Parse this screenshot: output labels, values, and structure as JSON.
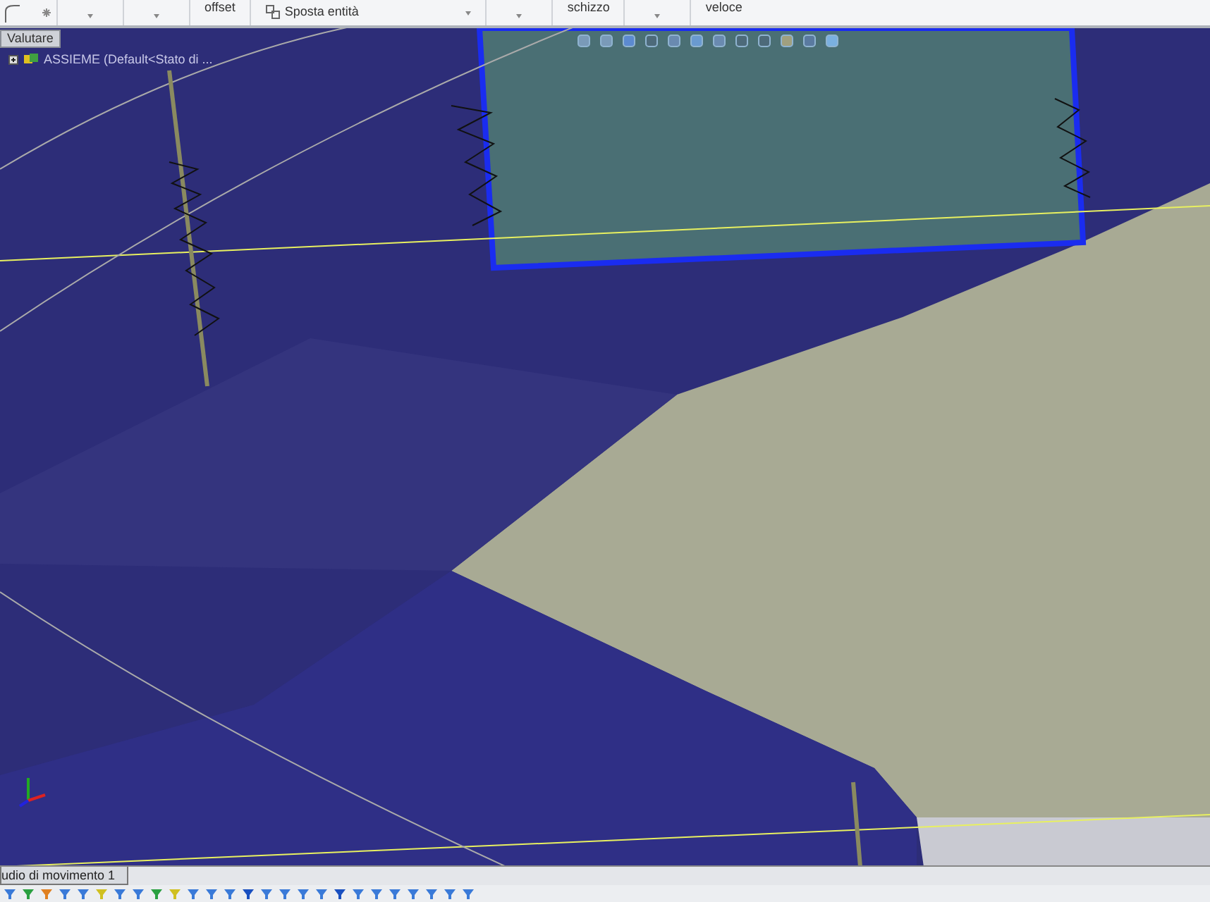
{
  "ribbon": {
    "groups": [
      {
        "kind": "caret_only",
        "dropdown": true
      },
      {
        "kind": "caret_only",
        "dropdown": true
      },
      {
        "label": "offset",
        "kind": "label",
        "dropdown": false
      },
      {
        "label": "Sposta entità",
        "kind": "wide",
        "dropdown": true
      },
      {
        "kind": "caret_only",
        "dropdown": true
      },
      {
        "label": "schizzo",
        "kind": "label",
        "dropdown": false
      },
      {
        "kind": "caret_only",
        "dropdown": true
      },
      {
        "label": "veloce",
        "kind": "label",
        "dropdown": false
      }
    ]
  },
  "tree": {
    "tab": "Valutare",
    "root": "ASSIEME  (Default<Stato di ..."
  },
  "bottom_tab": "udio di movimento 1"
}
